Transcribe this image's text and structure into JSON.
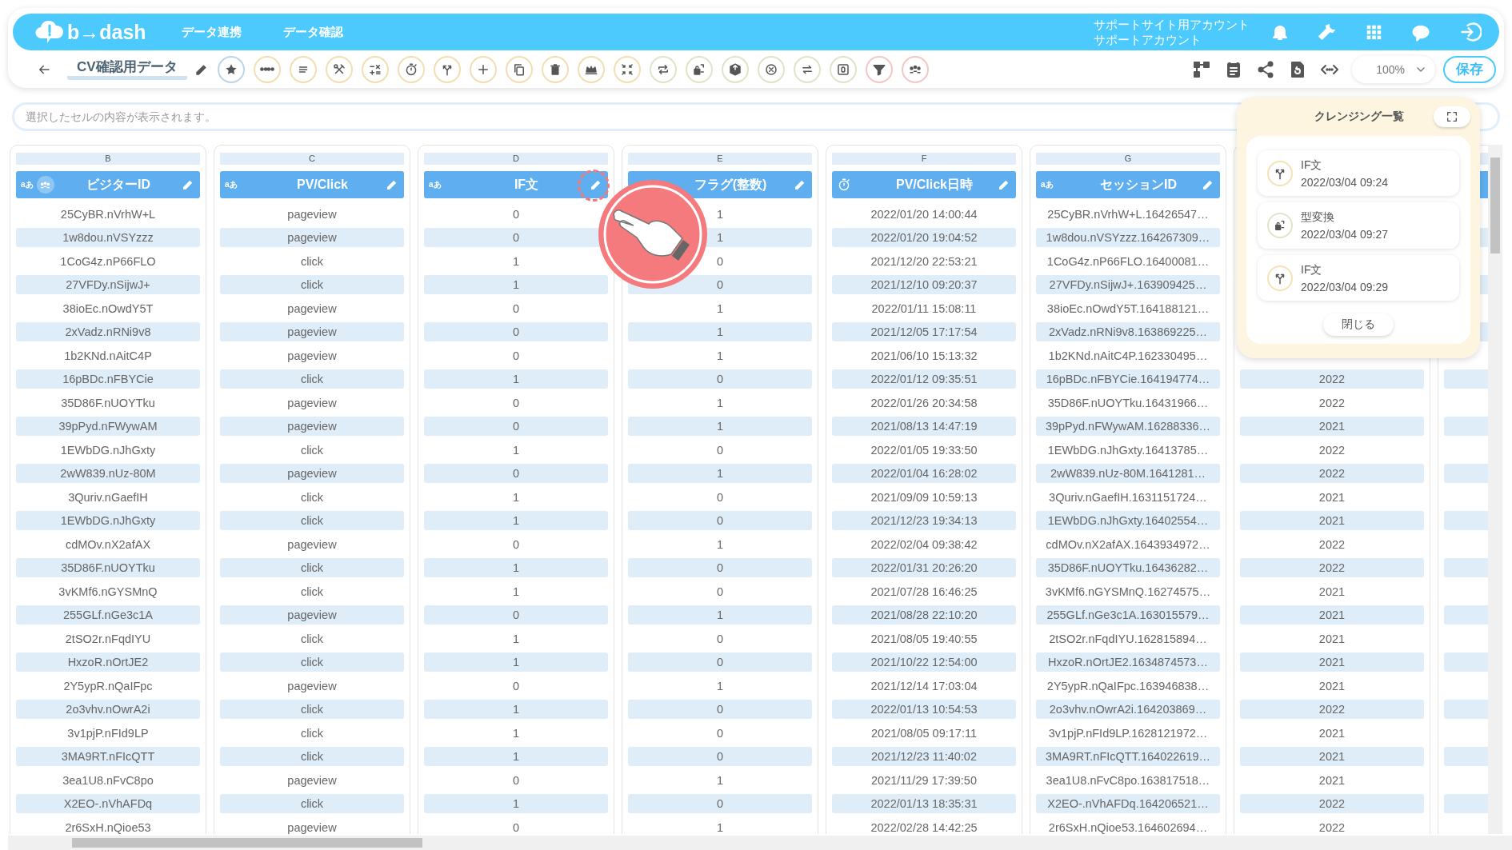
{
  "header": {
    "logo": "b→dash",
    "nav": [
      {
        "label": "データ連携"
      },
      {
        "label": "データ確認"
      }
    ],
    "account": {
      "site": "サポートサイト用アカウント",
      "user": "サポートアカウント"
    }
  },
  "toolbar": {
    "title": "CV確認用データ",
    "zoom": "100%",
    "save": "保存"
  },
  "cell_viewer": {
    "placeholder": "選択したセルの内容が表示されます。"
  },
  "columns": [
    {
      "letter": "B",
      "label": "ビジターID",
      "kind": "text",
      "badge": "aあ",
      "key": true,
      "highlighted": false,
      "cells": [
        "25CyBR.nVrhW+L",
        "1w8dou.nVSYzzz",
        "1CoG4z.nP66FLO",
        "27VFDy.nSijwJ+",
        "38ioEc.nOwdY5T",
        "2xVadz.nRNi9v8",
        "1b2KNd.nAitC4P",
        "16pBDc.nFBYCie",
        "35D86F.nUOYTku",
        "39pPyd.nFWywAM",
        "1EWbDG.nJhGxty",
        "2wW839.nUz-80M",
        "3Quriv.nGaefIH",
        "1EWbDG.nJhGxty",
        "cdMOv.nX2afAX",
        "35D86F.nUOYTku",
        "3vKMf6.nGYSMnQ",
        "255GLf.nGe3c1A",
        "2tSO2r.nFqdIYU",
        "HxzoR.nOrtJE2",
        "2Y5ypR.nQaIFpc",
        "2o3vhv.nOwrA2i",
        "3v1pjP.nFId9LP",
        "3MA9RT.nFIcQTT",
        "3ea1U8.nFvC8po",
        "X2EO-.nVhAFDq",
        "2r6SxH.nQioe53"
      ]
    },
    {
      "letter": "C",
      "label": "PV/Click",
      "kind": "text",
      "badge": "aあ",
      "key": false,
      "highlighted": false,
      "cells": [
        "pageview",
        "pageview",
        "click",
        "click",
        "pageview",
        "pageview",
        "pageview",
        "click",
        "pageview",
        "pageview",
        "click",
        "pageview",
        "click",
        "click",
        "pageview",
        "click",
        "click",
        "pageview",
        "click",
        "click",
        "pageview",
        "click",
        "click",
        "click",
        "pageview",
        "click",
        "pageview"
      ]
    },
    {
      "letter": "D",
      "label": "IF文",
      "kind": "text",
      "badge": "aあ",
      "key": false,
      "highlighted": true,
      "cells": [
        "0",
        "0",
        "1",
        "1",
        "0",
        "0",
        "0",
        "1",
        "0",
        "0",
        "1",
        "0",
        "1",
        "1",
        "0",
        "1",
        "1",
        "0",
        "1",
        "1",
        "0",
        "1",
        "1",
        "1",
        "0",
        "1",
        "0"
      ]
    },
    {
      "letter": "E",
      "label": "フラグ(整数)",
      "key": false,
      "highlighted": false,
      "cells": [
        "1",
        "1",
        "0",
        "0",
        "1",
        "1",
        "1",
        "0",
        "1",
        "1",
        "0",
        "1",
        "0",
        "0",
        "1",
        "0",
        "0",
        "1",
        "0",
        "0",
        "1",
        "0",
        "0",
        "0",
        "1",
        "0",
        "1"
      ]
    },
    {
      "letter": "F",
      "label": "PV/Click日時",
      "kind": "datetime",
      "key": false,
      "highlighted": false,
      "cells": [
        "2022/01/20 14:00:44",
        "2022/01/20 19:04:52",
        "2021/12/20 22:53:21",
        "2021/12/10 09:20:37",
        "2022/01/11 15:08:11",
        "2021/12/05 17:17:54",
        "2021/06/10 15:13:32",
        "2022/01/12 09:35:51",
        "2022/01/26 20:34:58",
        "2021/08/13 14:47:19",
        "2022/01/05 19:33:50",
        "2022/01/04 16:28:02",
        "2021/09/09 10:59:13",
        "2021/12/23 19:34:13",
        "2022/02/04 09:38:42",
        "2022/01/31 20:26:20",
        "2021/07/28 16:46:25",
        "2021/08/28 22:10:20",
        "2021/08/05 19:40:55",
        "2021/10/22 12:54:00",
        "2021/12/14 17:03:04",
        "2022/01/13 10:54:53",
        "2021/08/05 09:17:11",
        "2021/12/23 11:40:02",
        "2021/11/29 17:39:50",
        "2022/01/13 18:35:31",
        "2022/02/28 14:42:25"
      ]
    },
    {
      "letter": "G",
      "label": "セッションID",
      "kind": "text",
      "badge": "aあ",
      "key": false,
      "highlighted": false,
      "cells": [
        "25CyBR.nVrhW+L.16426547…",
        "1w8dou.nVSYzzz.164267309…",
        "1CoG4z.nP66FLO.16400081…",
        "27VFDy.nSijwJ+.163909425…",
        "38ioEc.nOwdY5T.164188121…",
        "2xVadz.nRNi9v8.163869225…",
        "1b2KNd.nAitC4P.162330495…",
        "16pBDc.nFBYCie.164194774…",
        "35D86F.nUOYTku.16431966…",
        "39pPyd.nFWywAM.16288336…",
        "1EWbDG.nJhGxty.16413785…",
        "2wW839.nUz-80M.1641281…",
        "3Quriv.nGaefIH.1631151724…",
        "1EWbDG.nJhGxty.16402554…",
        "cdMOv.nX2afAX.1643934972…",
        "35D86F.nUOYTku.16436282…",
        "3vKMf6.nGYSMnQ.16274575…",
        "255GLf.nGe3c1A.163015579…",
        "2tSO2r.nFqdIYU.162815894…",
        "HxzoR.nOrtJE2.1634874573…",
        "2Y5ypR.nQaIFpc.163946838…",
        "2o3vhv.nOwrA2i.164203869…",
        "3v1pjP.nFId9LP.1628121972…",
        "3MA9RT.nFIcQTT.164022619…",
        "3ea1U8.nFvC8po.163817518…",
        "X2EO-.nVhAFDq.164206521…",
        "2r6SxH.nQioe53.164602694…"
      ]
    },
    {
      "cells": [
        "2022",
        "2022",
        "2021",
        "2022",
        "2022",
        "2021",
        "2021",
        "2022",
        "2022",
        "2021",
        "2021",
        "2021",
        "2021",
        "2021",
        "2022",
        "2021",
        "2021",
        "2021",
        "2022",
        "2022"
      ]
    }
  ],
  "cleansing_panel": {
    "title": "クレンジング一覧",
    "items": [
      {
        "kind": "branch",
        "name": "IF文",
        "time": "2022/03/04 09:24"
      },
      {
        "kind": "convert",
        "name": "型変換",
        "time": "2022/03/04 09:27"
      },
      {
        "kind": "branch",
        "name": "IF文",
        "time": "2022/03/04 09:29"
      }
    ],
    "close": "閉じる"
  }
}
